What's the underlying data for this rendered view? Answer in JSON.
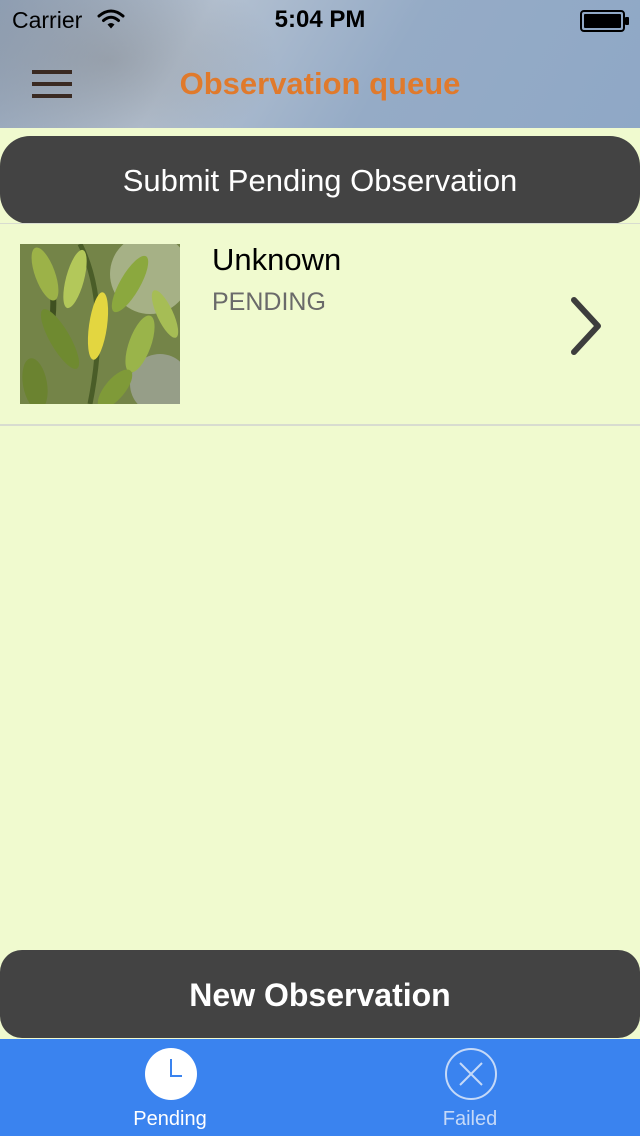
{
  "status_bar": {
    "carrier": "Carrier",
    "time": "5:04 PM"
  },
  "header": {
    "title": "Observation queue",
    "menu_icon": "hamburger-menu-icon"
  },
  "actions": {
    "submit_label": "Submit Pending Observation",
    "new_label": "New Observation"
  },
  "observations": [
    {
      "title": "Unknown",
      "status": "PENDING",
      "thumbnail_icon": "plant-photo",
      "chevron_icon": "chevron-right-icon"
    }
  ],
  "tabs": [
    {
      "label": "Pending",
      "icon": "clock-icon",
      "selected": true
    },
    {
      "label": "Failed",
      "icon": "x-circle-icon",
      "selected": false
    }
  ],
  "colors": {
    "title": "#e07a2c",
    "page_background": "#f0facf",
    "button_background": "#434343",
    "tab_bar": "#3a83ef"
  }
}
